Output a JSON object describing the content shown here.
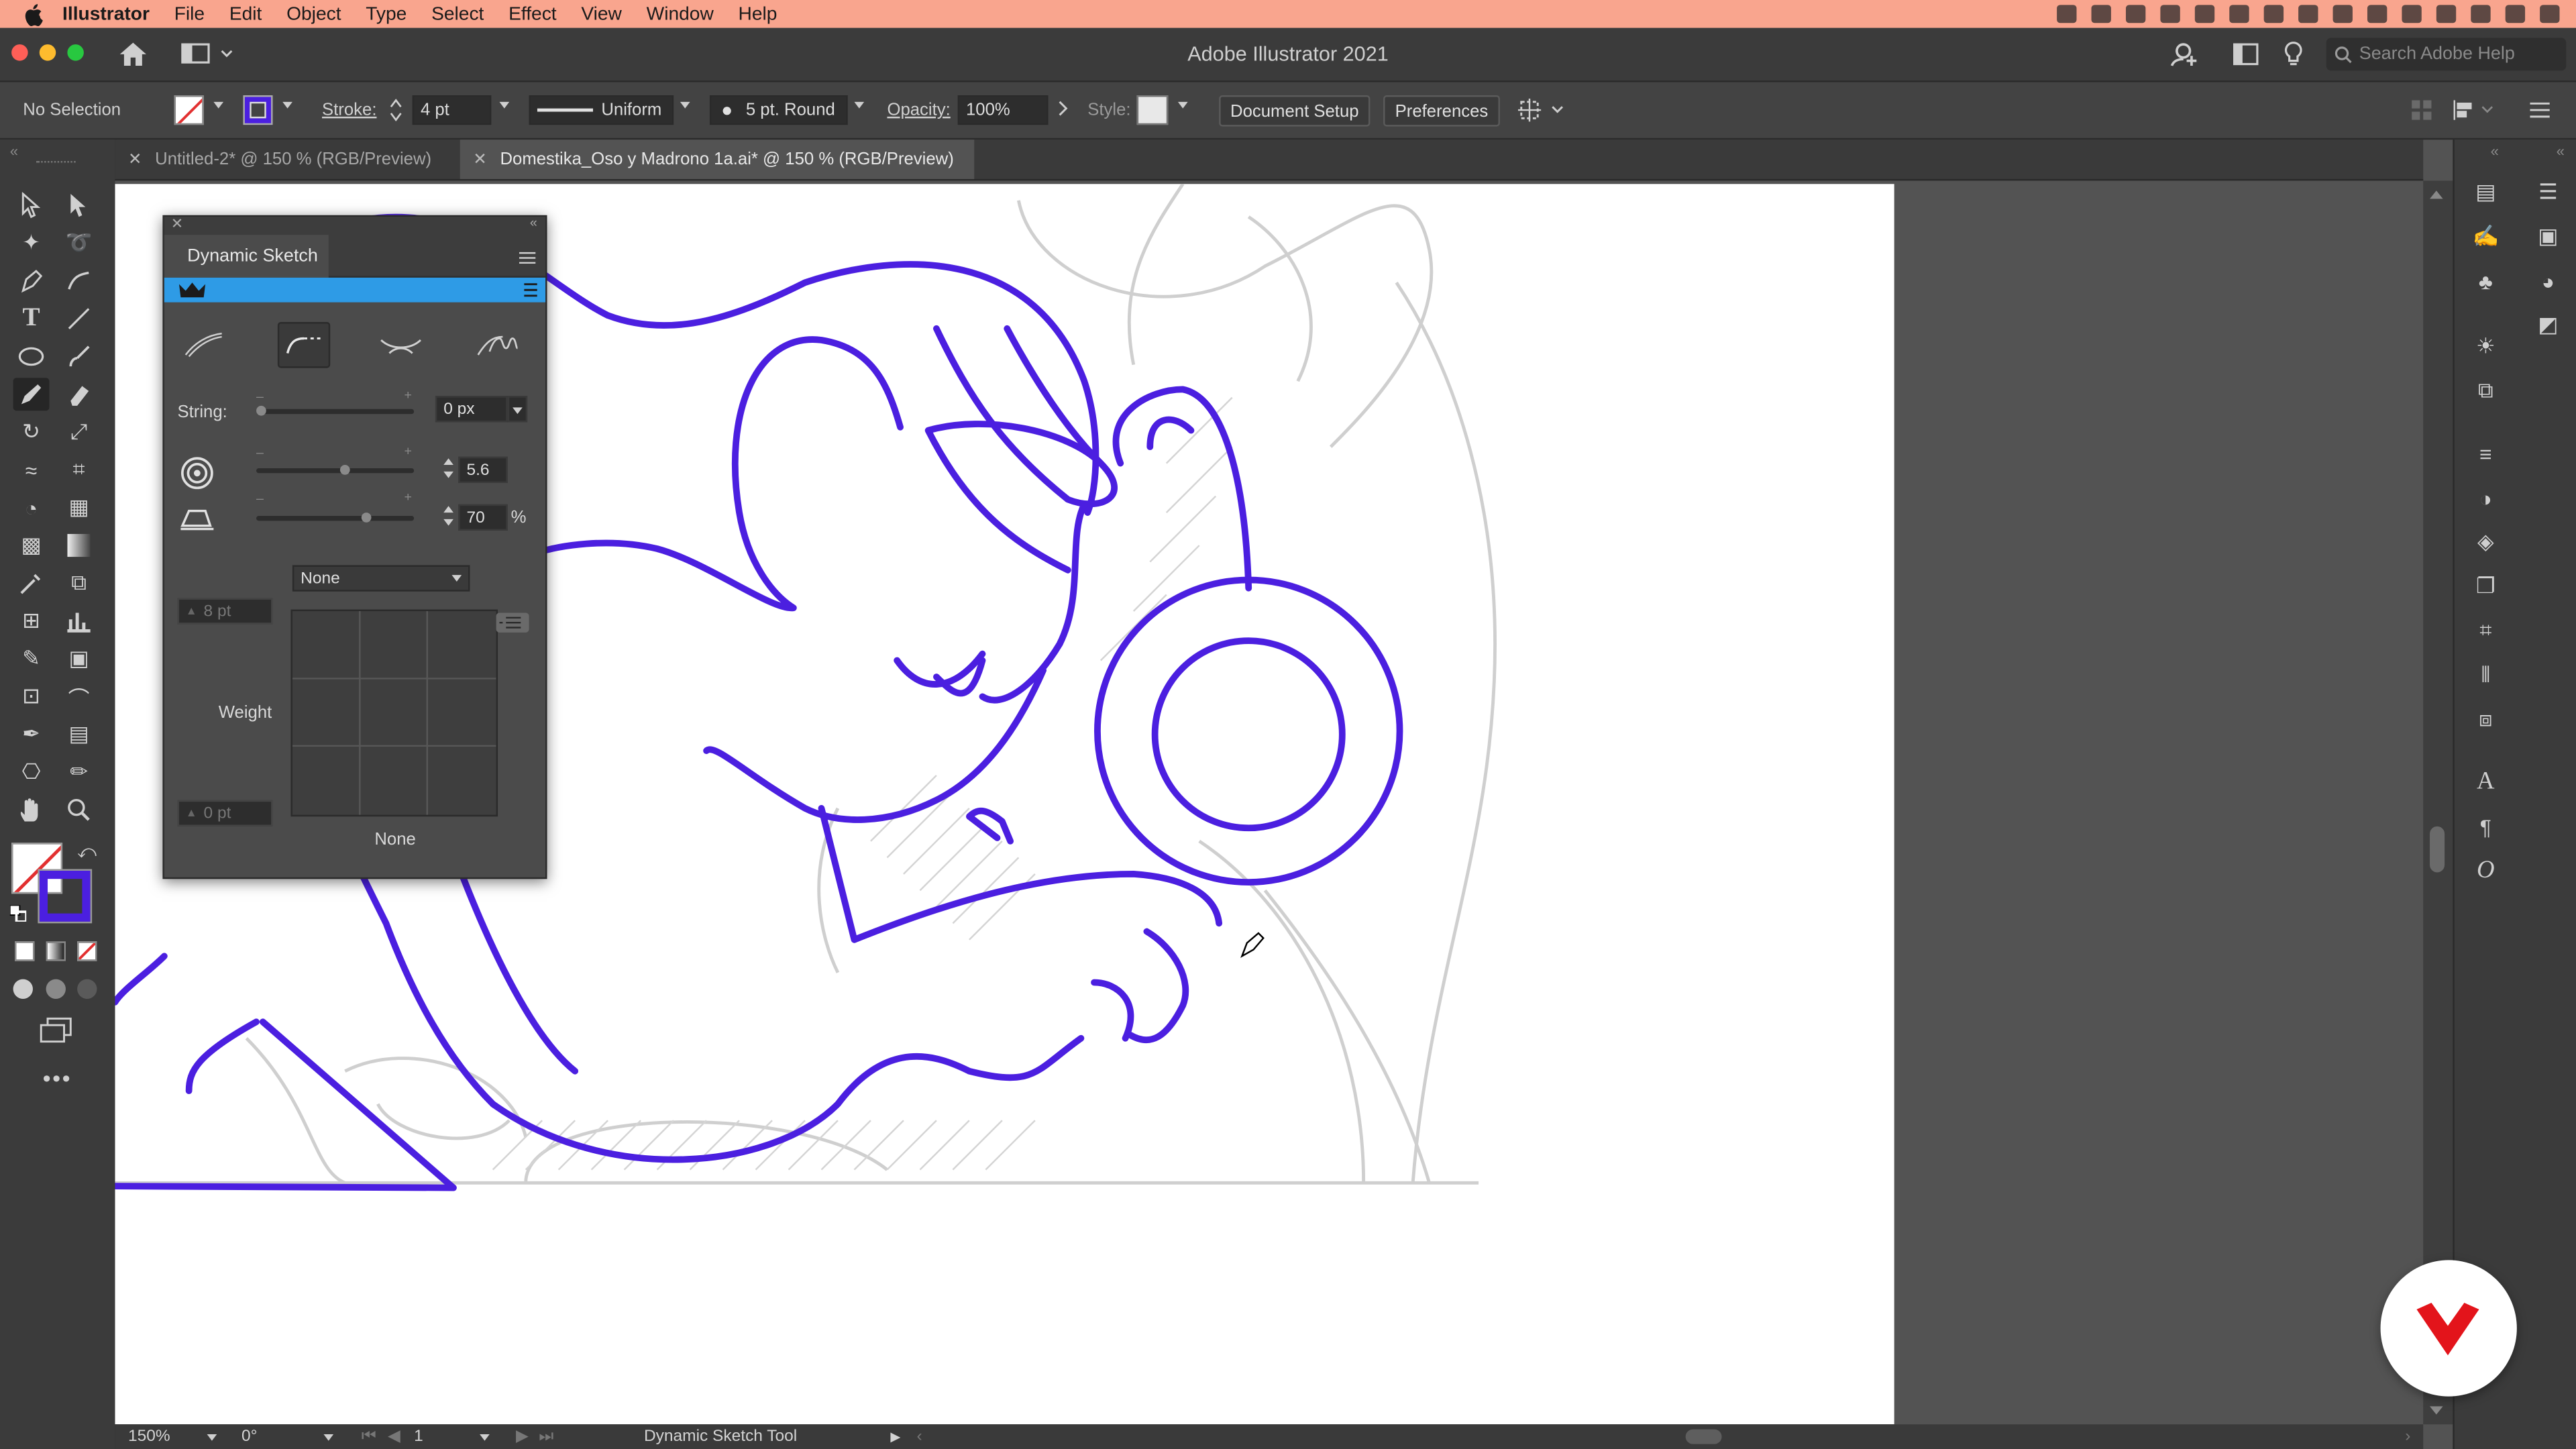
{
  "menubar": {
    "app": "Illustrator",
    "items": [
      "File",
      "Edit",
      "Object",
      "Type",
      "Select",
      "Effect",
      "View",
      "Window",
      "Help"
    ]
  },
  "titlebar": {
    "title": "Adobe Illustrator 2021",
    "search_placeholder": "Search Adobe Help"
  },
  "control": {
    "selection": "No Selection",
    "stroke_label": "Stroke:",
    "stroke_value": "4 pt",
    "profile": "Uniform",
    "brush": "5 pt. Round",
    "opacity_label": "Opacity:",
    "opacity_value": "100%",
    "style_label": "Style:",
    "document_setup": "Document Setup",
    "preferences": "Preferences"
  },
  "tabs": [
    {
      "label": "Untitled-2* @ 150 % (RGB/Preview)",
      "active": false
    },
    {
      "label": "Domestika_Oso y Madrono 1a.ai* @ 150 % (RGB/Preview)",
      "active": true
    }
  ],
  "panel": {
    "title": "Dynamic Sketch",
    "string_label": "String:",
    "string_value": "0 px",
    "value_1": "5.6",
    "value_2": "70",
    "percent": "%",
    "dropdown": "None",
    "pt_top": "8 pt",
    "pt_bottom": "0 pt",
    "weight_label": "Weight",
    "graph_caption": "None"
  },
  "status": {
    "zoom": "150%",
    "rotation": "0°",
    "artboard": "1",
    "tool": "Dynamic Sketch Tool"
  },
  "colors": {
    "stroke_purple": "#4b1fe0",
    "accent_blue": "#2e9be6",
    "menubar": "#f9a58e",
    "brand_red": "#e3141b"
  },
  "icons": [
    "apple-icon",
    "home-icon",
    "workspace-icon",
    "selection-tool-icon",
    "pen-tool-icon",
    "type-tool-icon",
    "dynamic-sketch-icon",
    "hand-tool-icon",
    "zoom-tool-icon",
    "domestika-logo-icon"
  ]
}
